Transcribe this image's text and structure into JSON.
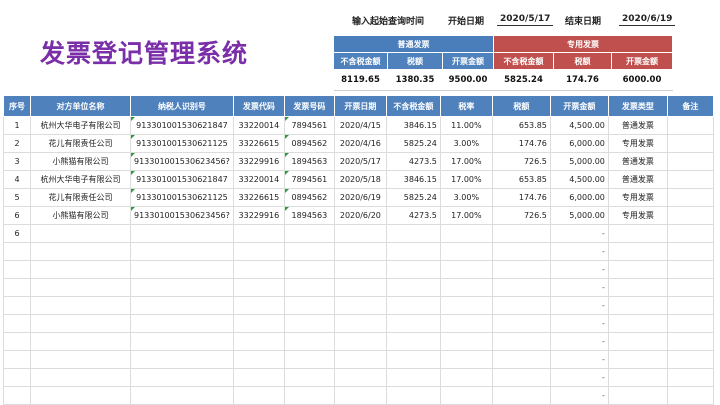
{
  "title": "发票登记管理系统",
  "query": {
    "label": "输入起始查询时间",
    "start_label": "开始日期",
    "start_value": "2020/5/17",
    "end_label": "结束日期",
    "end_value": "2020/6/19"
  },
  "summary": {
    "normal_header": "普通发票",
    "special_header": "专用发票",
    "sub_headers": [
      "不含税金额",
      "税额",
      "开票金额",
      "不含税金额",
      "税额",
      "开票金额"
    ],
    "values": [
      "8119.65",
      "1380.35",
      "9500.00",
      "5825.24",
      "174.76",
      "6000.00"
    ]
  },
  "table": {
    "headers": [
      "序号",
      "对方单位名称",
      "纳税人识别号",
      "发票代码",
      "发票号码",
      "开票日期",
      "不含税金额",
      "税率",
      "税额",
      "开票金额",
      "发票类型",
      "备注"
    ],
    "rows": [
      [
        "1",
        "杭州大华电子有限公司",
        "913301001530621847",
        "33220014",
        "7894561",
        "2020/4/15",
        "3846.15",
        "11.00%",
        "653.85",
        "4,500.00",
        "普通发票",
        ""
      ],
      [
        "2",
        "花儿有限责任公司",
        "913301001530621125",
        "33226615",
        "0894562",
        "2020/4/16",
        "5825.24",
        "3.00%",
        "174.76",
        "6,000.00",
        "专用发票",
        ""
      ],
      [
        "3",
        "小熊猫有限公司",
        "913301001530623456?",
        "33229916",
        "1894563",
        "2020/5/17",
        "4273.5",
        "17.00%",
        "726.5",
        "5,000.00",
        "普通发票",
        ""
      ],
      [
        "4",
        "杭州大华电子有限公司",
        "913301001530621847",
        "33220014",
        "7894561",
        "2020/5/18",
        "3846.15",
        "17.00%",
        "653.85",
        "4,500.00",
        "普通发票",
        ""
      ],
      [
        "5",
        "花儿有限责任公司",
        "913301001530621125",
        "33226615",
        "0894562",
        "2020/6/19",
        "5825.24",
        "3.00%",
        "174.76",
        "6,000.00",
        "专用发票",
        ""
      ],
      [
        "6",
        "小熊猫有限公司",
        "913301001530623456?",
        "33229916",
        "1894563",
        "2020/6/20",
        "4273.5",
        "17.00%",
        "726.5",
        "5,000.00",
        "专用发票",
        ""
      ]
    ],
    "row6_index": "6",
    "empty_marker": "-"
  }
}
